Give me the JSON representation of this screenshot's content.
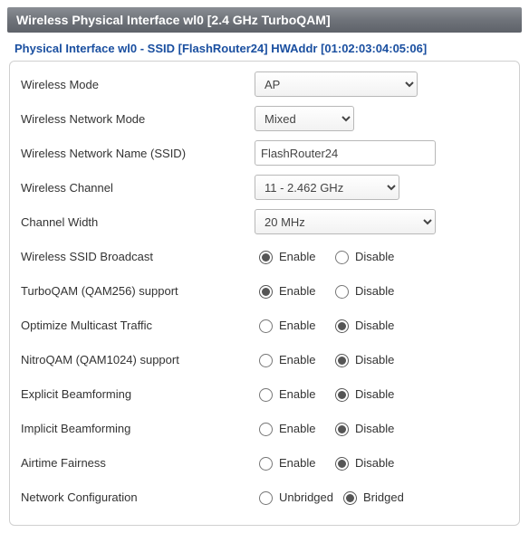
{
  "header": "Wireless Physical Interface wl0 [2.4 GHz TurboQAM]",
  "subheader": "Physical Interface wl0 - SSID [FlashRouter24] HWAddr [01:02:03:04:05:06]",
  "labels": {
    "mode": "Wireless Mode",
    "netmode": "Wireless Network Mode",
    "ssid": "Wireless Network Name (SSID)",
    "channel": "Wireless Channel",
    "width": "Channel Width",
    "broadcast": "Wireless SSID Broadcast",
    "turboqam": "TurboQAM (QAM256) support",
    "multicast": "Optimize Multicast Traffic",
    "nitroqam": "NitroQAM (QAM1024) support",
    "ebf": "Explicit Beamforming",
    "ibf": "Implicit Beamforming",
    "atf": "Airtime Fairness",
    "netconf": "Network Configuration"
  },
  "values": {
    "mode": "AP",
    "netmode": "Mixed",
    "ssid": "FlashRouter24",
    "channel": "11 - 2.462 GHz",
    "width": "20 MHz"
  },
  "opts": {
    "enable": "Enable",
    "disable": "Disable",
    "unbridged": "Unbridged",
    "bridged": "Bridged"
  },
  "radios": {
    "broadcast": "enable",
    "turboqam": "enable",
    "multicast": "disable",
    "nitroqam": "disable",
    "ebf": "disable",
    "ibf": "disable",
    "atf": "disable",
    "netconf": "bridged"
  }
}
